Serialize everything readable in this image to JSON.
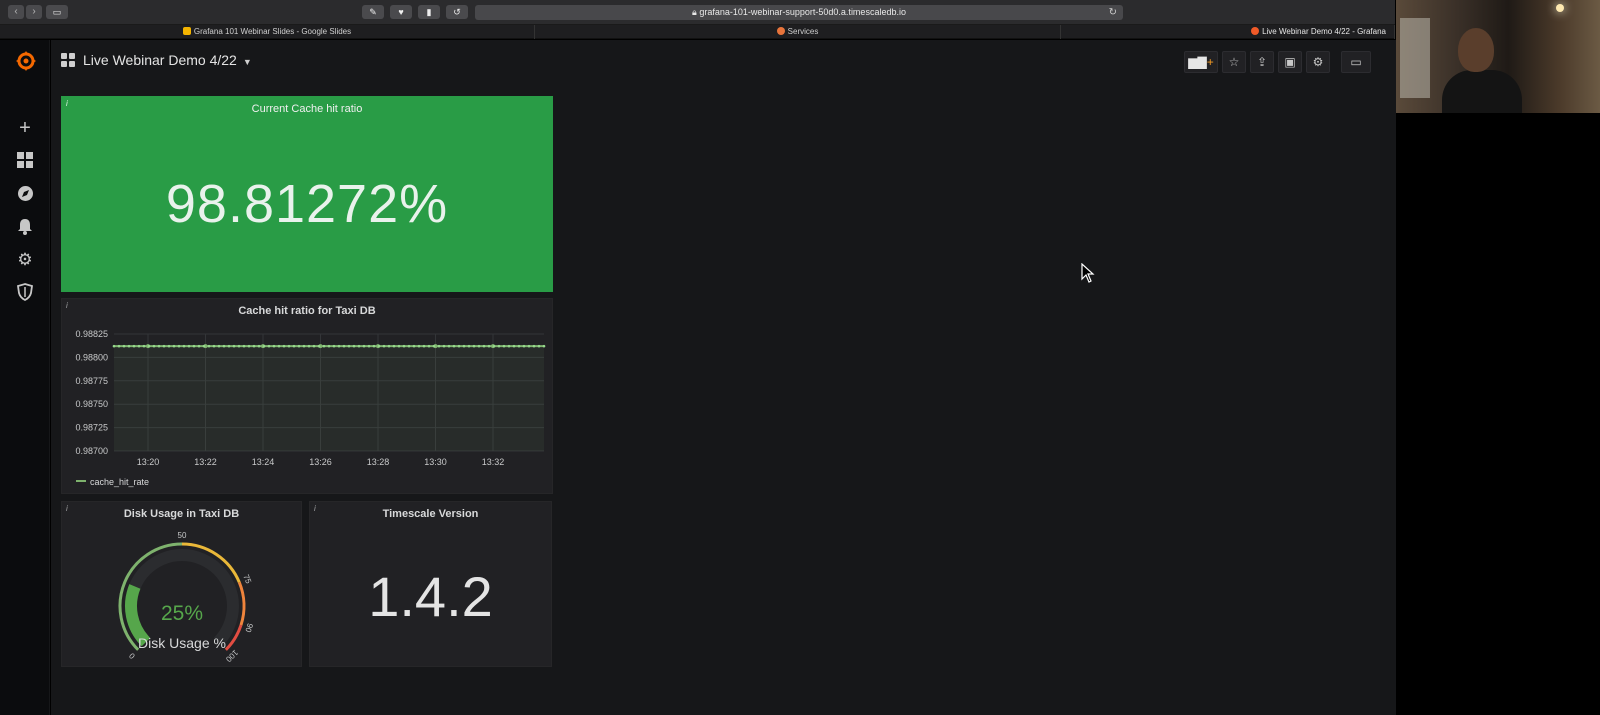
{
  "browser": {
    "url": "grafana-101-webinar-support-50d0.a.timescaledb.io",
    "tabs": [
      "Grafana 101 Webinar Slides - Google Slides",
      "Services",
      "Live Webinar Demo 4/22 - Grafana"
    ]
  },
  "dashboard": {
    "title": "Live Webinar Demo 4/22"
  },
  "panels": {
    "cache_current": {
      "title": "Current Cache hit ratio",
      "value": "98.81272%",
      "info": "i"
    },
    "cache_graph": {
      "title": "Cache hit ratio for Taxi DB",
      "info": "i",
      "legend": "cache_hit_rate"
    },
    "disk": {
      "title": "Disk Usage in Taxi DB",
      "info": "i",
      "value": "25%",
      "label": "Disk Usage %"
    },
    "version": {
      "title": "Timescale Version",
      "info": "i",
      "value": "1.4.2"
    }
  },
  "colors": {
    "panel_green": "#299c46",
    "series_green": "#7eb26d",
    "gauge_yellow": "#eab839",
    "gauge_orange": "#ef843c",
    "gauge_red": "#e24d42"
  },
  "chart_data": [
    {
      "type": "line",
      "x": [
        "13:20",
        "13:22",
        "13:24",
        "13:26",
        "13:28",
        "13:30",
        "13:32"
      ],
      "series": [
        {
          "name": "cache_hit_rate",
          "values": [
            0.98812,
            0.98812,
            0.98812,
            0.98812,
            0.98812,
            0.98812,
            0.98812
          ]
        }
      ],
      "yticks": [
        "0.98825",
        "0.98800",
        "0.98775",
        "0.98750",
        "0.98725",
        "0.98700"
      ],
      "ylim": [
        0.987,
        0.98825
      ],
      "grid": true,
      "legend": "bottom-left"
    },
    {
      "type": "gauge",
      "value": 25,
      "range": [
        0,
        100
      ],
      "ticks": [
        "0",
        "50",
        "75",
        "90",
        "100"
      ],
      "thresholds": [
        50,
        75,
        90
      ]
    }
  ]
}
